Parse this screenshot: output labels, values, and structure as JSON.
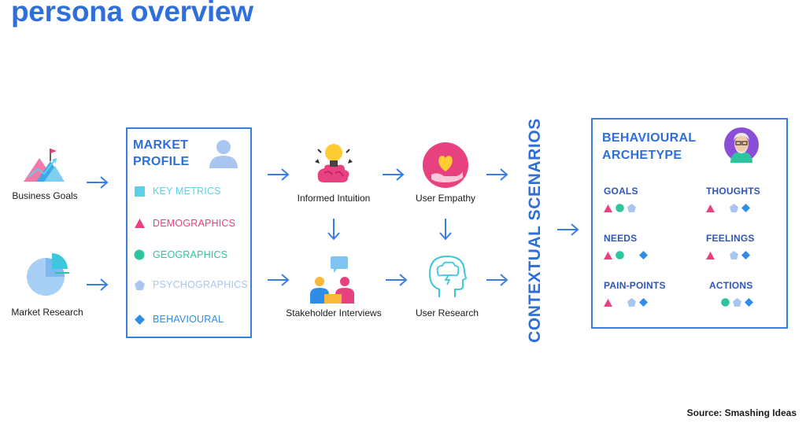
{
  "title": "persona overview",
  "colors": {
    "accent": "#2e6fdc",
    "key_metrics": "#5ad0ea",
    "demographics": "#e8417f",
    "geographics": "#2ec4a0",
    "psychographics": "#a8c6f0",
    "behavioural": "#2f8de8"
  },
  "inputs": [
    {
      "label": "Business Goals",
      "icon": "mountain-flag-icon"
    },
    {
      "label": "Market Research",
      "icon": "pie-chart-icon"
    }
  ],
  "market_profile": {
    "title_line1": "MARKET",
    "title_line2": "PROFILE",
    "icon": "user-icon",
    "items": [
      {
        "label": "KEY METRICS",
        "shape": "square"
      },
      {
        "label": "DEMOGRAPHICS",
        "shape": "triangle"
      },
      {
        "label": "GEOGRAPHICS",
        "shape": "circle"
      },
      {
        "label": "PSYCHOGRAPHICS",
        "shape": "pentagon"
      },
      {
        "label": "BEHAVIOURAL",
        "shape": "diamond"
      }
    ]
  },
  "process": {
    "informed_intuition": "Informed Intuition",
    "user_empathy": "User Empathy",
    "stakeholder_interviews": "Stakeholder Interviews",
    "user_research": "User Research"
  },
  "contextual_scenarios": "CONTEXTUAL SCENARIOS",
  "behavioural_archetype": {
    "title_line1": "BEHAVIOURAL",
    "title_line2": "ARCHETYPE",
    "icon": "avatar-icon",
    "sections": [
      {
        "label": "GOALS",
        "marks": [
          "triangle",
          "circle",
          "pentagon",
          "none"
        ]
      },
      {
        "label": "THOUGHTS",
        "marks": [
          "triangle",
          "none",
          "pentagon",
          "diamond"
        ]
      },
      {
        "label": "NEEDS",
        "marks": [
          "triangle",
          "circle",
          "none",
          "diamond"
        ]
      },
      {
        "label": "FEELINGS",
        "marks": [
          "triangle",
          "none",
          "pentagon",
          "diamond"
        ]
      },
      {
        "label": "PAIN-POINTS",
        "marks": [
          "triangle",
          "none",
          "pentagon",
          "diamond"
        ]
      },
      {
        "label": "ACTIONS",
        "marks": [
          "none",
          "circle",
          "pentagon",
          "diamond"
        ]
      }
    ]
  },
  "source": "Source: Smashing Ideas"
}
